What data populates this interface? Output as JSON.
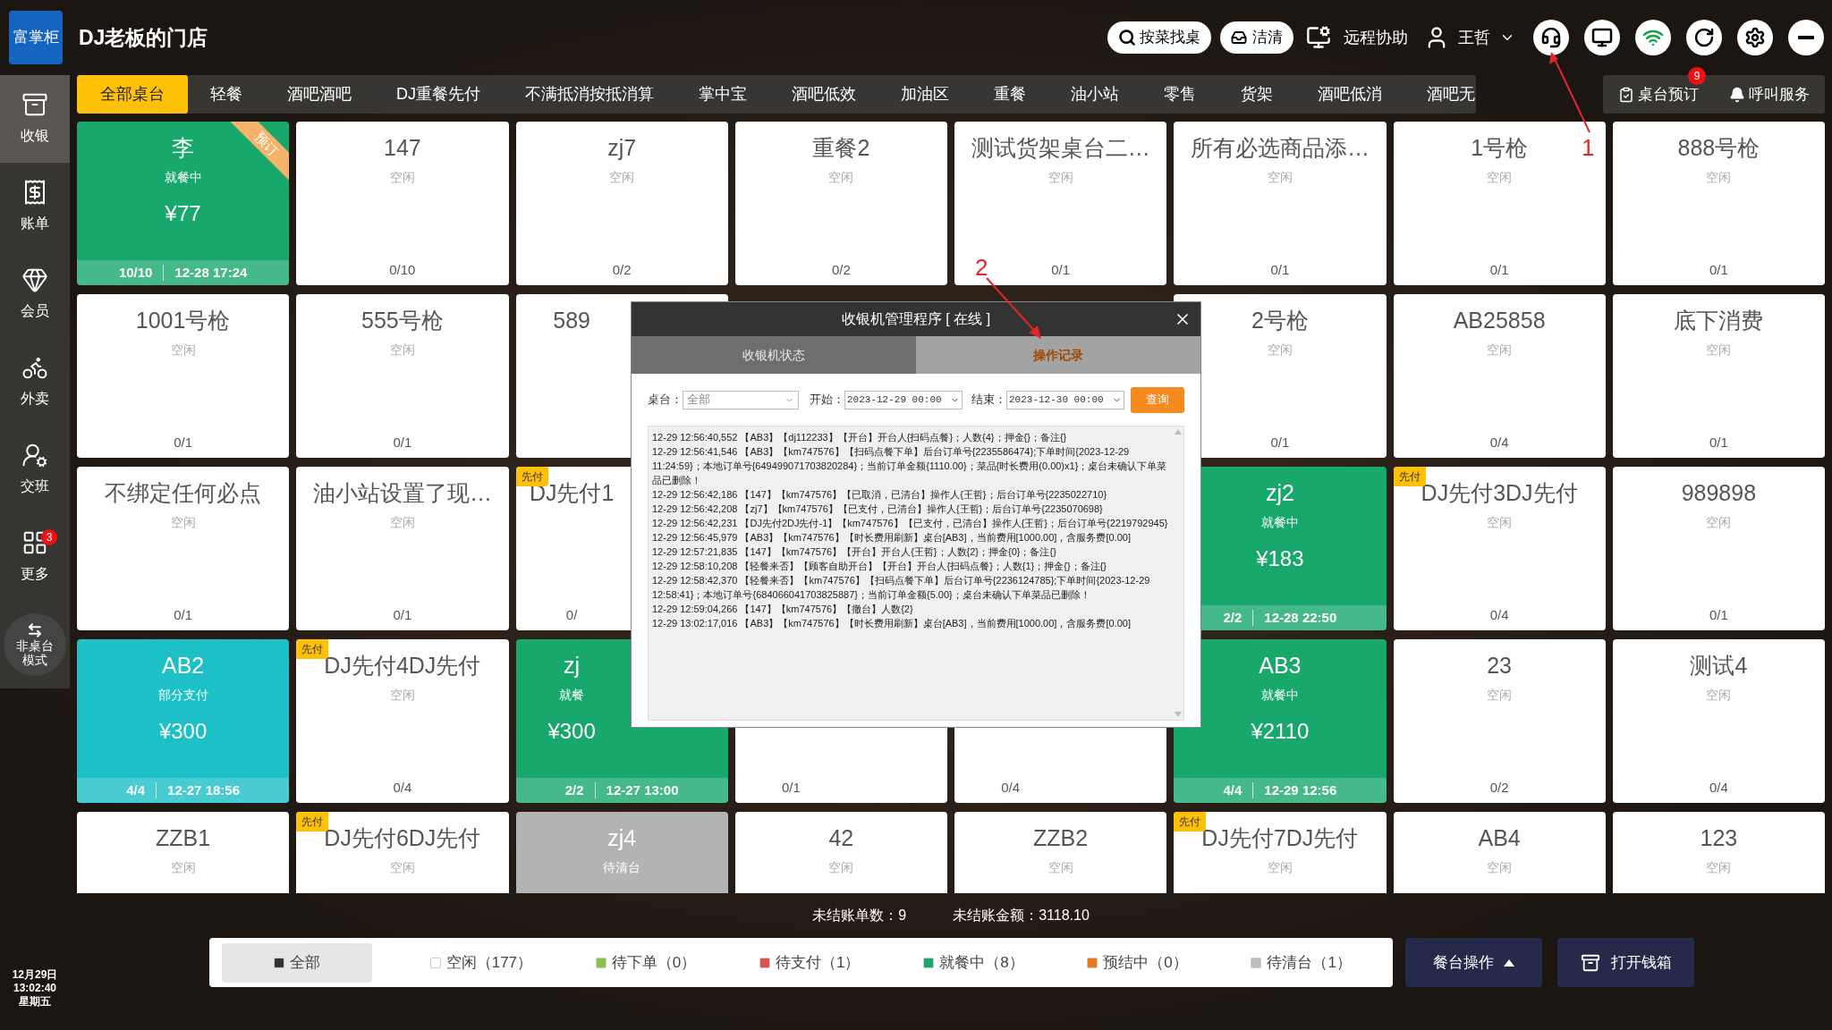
{
  "header": {
    "logo": "富掌柜",
    "store": "DJ老板的门店",
    "find_button": "按菜找桌",
    "clean_button": "洁清",
    "remote": "远程协助",
    "user": "王哲"
  },
  "sidebar": {
    "items": [
      {
        "label": "收银",
        "selected": true
      },
      {
        "label": "账单",
        "selected": false
      },
      {
        "label": "会员",
        "selected": false
      },
      {
        "label": "外卖",
        "selected": false
      },
      {
        "label": "交班",
        "selected": false
      },
      {
        "label": "更多",
        "selected": false,
        "badge": "3"
      }
    ],
    "mode_button": [
      "非桌台",
      "模式"
    ],
    "date": "12月29日",
    "time": "13:02:40",
    "weekday": "星期五"
  },
  "tabs": [
    {
      "label": "全部桌台",
      "selected": true
    },
    {
      "label": "轻餐",
      "selected": false
    },
    {
      "label": "酒吧酒吧",
      "selected": false
    },
    {
      "label": "DJ重餐先付",
      "selected": false
    },
    {
      "label": "不满抵消按抵消算",
      "selected": false
    },
    {
      "label": "掌中宝",
      "selected": false
    },
    {
      "label": "酒吧低效",
      "selected": false
    },
    {
      "label": "加油区",
      "selected": false
    },
    {
      "label": "重餐",
      "selected": false
    },
    {
      "label": "油小站",
      "selected": false
    },
    {
      "label": "零售",
      "selected": false
    },
    {
      "label": "货架",
      "selected": false
    },
    {
      "label": "酒吧低消",
      "selected": false
    },
    {
      "label": "酒吧无",
      "selected": false
    }
  ],
  "reserve_button": {
    "label": "桌台预订",
    "badge": "9"
  },
  "call_button": "呼叫服务",
  "cards": [
    {
      "kind": "dining",
      "covered": false,
      "name": "李",
      "status": "就餐中",
      "price": "¥77",
      "count": "10/10",
      "time": "12-28 17:24",
      "ribbon": "预订"
    },
    {
      "kind": "idle",
      "covered": false,
      "name": "147",
      "status": "空闲",
      "count": "0/10"
    },
    {
      "kind": "idle",
      "covered": false,
      "name": "zj7",
      "status": "空闲",
      "count": "0/2"
    },
    {
      "kind": "idle",
      "covered": false,
      "name": "重餐2",
      "status": "空闲",
      "count": "0/2"
    },
    {
      "kind": "idle",
      "covered": false,
      "name": "测试货架桌台二…",
      "status": "空闲",
      "count": "0/1"
    },
    {
      "kind": "idle",
      "covered": false,
      "name": "所有必选商品添…",
      "status": "空闲",
      "count": "0/1"
    },
    {
      "kind": "idle",
      "covered": false,
      "name": "1号枪",
      "status": "空闲",
      "count": "0/1"
    },
    {
      "kind": "idle",
      "covered": false,
      "name": "888号枪",
      "status": "空闲",
      "count": "0/1"
    },
    {
      "kind": "idle",
      "covered": false,
      "name": "1001号枪",
      "status": "空闲",
      "count": "0/1"
    },
    {
      "kind": "idle",
      "covered": false,
      "name": "555号枪",
      "status": "空闲",
      "count": "0/1"
    },
    {
      "kind": "idle",
      "covered": true,
      "name": "589"
    },
    {
      "kind": "hidden"
    },
    {
      "kind": "hidden"
    },
    {
      "kind": "idle",
      "covered": false,
      "name": "2号枪",
      "status": "空闲",
      "count": "0/1"
    },
    {
      "kind": "idle",
      "covered": false,
      "name": "AB25858",
      "status": "空闲",
      "count": "0/4"
    },
    {
      "kind": "idle",
      "covered": false,
      "name": "底下消费",
      "status": "空闲",
      "count": "0/1"
    },
    {
      "kind": "idle",
      "covered": false,
      "name": "不绑定任何必点",
      "status": "空闲",
      "count": "0/1"
    },
    {
      "kind": "idle",
      "covered": false,
      "name": "油小站设置了现…",
      "status": "空闲",
      "count": "0/1"
    },
    {
      "kind": "idle",
      "covered": true,
      "name": "DJ先付1",
      "count": "0/",
      "tag": "先付"
    },
    {
      "kind": "hidden"
    },
    {
      "kind": "hidden"
    },
    {
      "kind": "dining",
      "covered": false,
      "name": "zj2",
      "status": "就餐中",
      "price": "¥183",
      "count": "2/2",
      "time": "12-28 22:50"
    },
    {
      "kind": "idle",
      "covered": false,
      "name": "DJ先付3DJ先付",
      "status": "空闲",
      "count": "0/4",
      "tag": "先付"
    },
    {
      "kind": "idle",
      "covered": false,
      "name": "989898",
      "status": "空闲",
      "count": "0/1"
    },
    {
      "kind": "partpay",
      "covered": false,
      "name": "AB2",
      "status": "部分支付",
      "price": "¥300",
      "count": "4/4",
      "time": "12-27 18:56"
    },
    {
      "kind": "idle",
      "covered": false,
      "name": "DJ先付4DJ先付",
      "status": "空闲",
      "count": "0/4",
      "tag": "先付"
    },
    {
      "kind": "dining",
      "covered": true,
      "name": "zj",
      "status": "就餐",
      "price": "¥300",
      "count": "2/2",
      "time": "12-27 13:00"
    },
    {
      "kind": "idle",
      "covered": true,
      "count": "0/1"
    },
    {
      "kind": "idle",
      "covered": true,
      "count": "0/4"
    },
    {
      "kind": "dining",
      "covered": false,
      "name": "AB3",
      "status": "就餐中",
      "price": "¥2110",
      "count": "4/4",
      "time": "12-29 12:56"
    },
    {
      "kind": "idle",
      "covered": false,
      "name": "23",
      "status": "空闲",
      "count": "0/2"
    },
    {
      "kind": "idle",
      "covered": false,
      "name": "测试4",
      "status": "空闲",
      "count": "0/4"
    },
    {
      "kind": "idle",
      "covered": false,
      "name": "ZZB1",
      "status": "空闲"
    },
    {
      "kind": "idle",
      "covered": false,
      "name": "DJ先付6DJ先付",
      "status": "空闲",
      "tag": "先付"
    },
    {
      "kind": "clearing",
      "covered": false,
      "name": "zj4",
      "status": "待清台"
    },
    {
      "kind": "idle",
      "covered": false,
      "name": "42",
      "status": "空闲"
    },
    {
      "kind": "idle",
      "covered": false,
      "name": "ZZB2",
      "status": "空闲"
    },
    {
      "kind": "idle",
      "covered": false,
      "name": "DJ先付7DJ先付",
      "status": "空闲",
      "tag": "先付"
    },
    {
      "kind": "idle",
      "covered": false,
      "name": "AB4",
      "status": "空闲"
    },
    {
      "kind": "idle",
      "covered": false,
      "name": "123",
      "status": "空闲"
    }
  ],
  "summary": {
    "unpaid_count": "未结账单数：9",
    "unpaid_amount": "未结账金额：3118.10"
  },
  "filters": [
    {
      "label": "全部",
      "color": "#333333",
      "selected": true
    },
    {
      "label": "空闲（177）",
      "color": "#ffffff",
      "selected": false
    },
    {
      "label": "待下单（0）",
      "color": "#8bc34a",
      "selected": false
    },
    {
      "label": "待支付（1）",
      "color": "#d9534f",
      "selected": false
    },
    {
      "label": "就餐中（8）",
      "color": "#18a86b",
      "selected": false
    },
    {
      "label": "预结中（0）",
      "color": "#e87722",
      "selected": false
    },
    {
      "label": "待清台（1）",
      "color": "#bdbdbd",
      "selected": false
    }
  ],
  "table_ops_button": "餐台操作",
  "cash_drawer_button": "打开钱箱",
  "dialog": {
    "title": "收银机管理程序 [ 在线 ]",
    "tabs": [
      {
        "label": "收银机状态",
        "selected": false
      },
      {
        "label": "操作记录",
        "selected": true
      }
    ],
    "table_label": "桌台：",
    "table_value": "全部",
    "start_label": "开始：",
    "start_value": "2023-12-29 00:00",
    "end_label": "结束：",
    "end_value": "2023-12-30 00:00",
    "query_button": "查询",
    "log": [
      "12-29 12:56:40,552 【AB3】【dj112233】【开台】开台人{扫码点餐}；人数{4}；押金{}；备注{}",
      "12-29 12:56:41,546 【AB3】【km747576】【扫码点餐下单】后台订单号{2235586474};下单时间{2023-12-29 11:24:59}；本地订单号{649499071703820284}；当前订单金额{1110.00}；菜品{时长费用(0.00)x1}；桌台未确认下单菜品已删除！",
      "12-29 12:56:42,186 【147】【km747576】【已取消，已清台】操作人{王哲}；后台订单号{2235022710}",
      "12-29 12:56:42,208 【zj7】【km747576】【已支付，已清台】操作人{王哲}；后台订单号{2235070698}",
      "12-29 12:56:42,231 【DJ先付2DJ先付-1】【km747576】【已支付，已清台】操作人{王哲}；后台订单号{2219792945}",
      "12-29 12:56:45,979 【AB3】【km747576】【时长费用刷新】桌台[AB3]，当前费用[1000.00]，含服务费[0.00]",
      "12-29 12:57:21,835 【147】【km747576】【开台】开台人{王哲}；人数{2}；押金{0}；备注{}",
      "12-29 12:58:10,208 【轻餐来否】【顾客自助开台】【开台】开台人{扫码点餐}；人数{1}；押金{}；备注{}",
      "12-29 12:58:42,370 【轻餐来否】【km747576】【扫码点餐下单】后台订单号{2236124785};下单时间{2023-12-29 12:58:41}；本地订单号{684066041703825887}；当前订单金额{5.00}；桌台未确认下单菜品已删除！",
      "12-29 12:59:04,266 【147】【km747576】【撤台】人数{2}",
      "12-29 13:02:17,016 【AB3】【km747576】【时长费用刷新】桌台[AB3]，当前费用[1000.00]，含服务费[0.00]"
    ]
  },
  "annotations": [
    "1",
    "2"
  ]
}
